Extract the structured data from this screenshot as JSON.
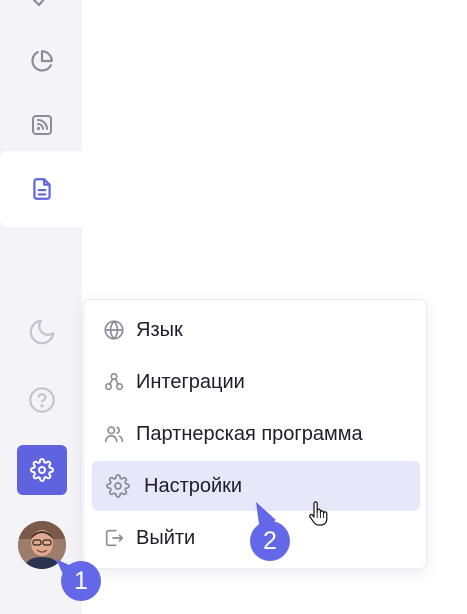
{
  "sidebar": {
    "items": [
      {
        "name": "checkmark-icon"
      },
      {
        "name": "pie-chart-icon"
      },
      {
        "name": "rss-feed-icon"
      },
      {
        "name": "document-icon",
        "active": true
      },
      {
        "name": "moon-icon"
      },
      {
        "name": "help-circle-icon"
      },
      {
        "name": "gear-icon",
        "selected": true
      },
      {
        "name": "user-avatar"
      }
    ]
  },
  "menu": {
    "items": [
      {
        "label": "Язык",
        "icon": "globe-icon"
      },
      {
        "label": "Интеграции",
        "icon": "integrations-icon"
      },
      {
        "label": "Партнерская программа",
        "icon": "partners-icon"
      },
      {
        "label": "Настройки",
        "icon": "gear-icon",
        "highlighted": true
      },
      {
        "label": "Выйти",
        "icon": "logout-icon"
      }
    ]
  },
  "annotations": {
    "step1": "1",
    "step2": "2"
  },
  "colors": {
    "accent": "#5f63df",
    "badge": "#6467e8",
    "sidebar_bg": "#f3f3f8",
    "highlight_bg": "#e6e8fa",
    "icon_gray": "#8b8b99"
  }
}
